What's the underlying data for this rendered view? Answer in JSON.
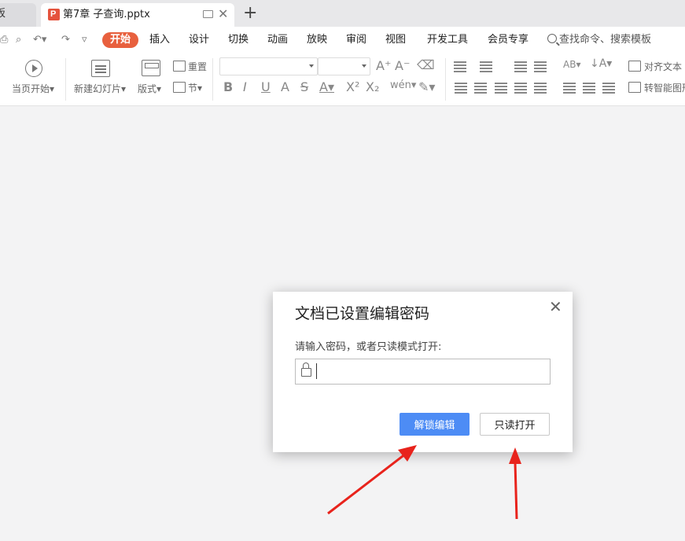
{
  "tabs": {
    "previous_tab_label": "板",
    "active_tab_title": "第7章 子查询.pptx"
  },
  "menu": {
    "items": [
      "开始",
      "插入",
      "设计",
      "切换",
      "动画",
      "放映",
      "审阅",
      "视图",
      "开发工具",
      "会员专享"
    ],
    "active_item": "开始",
    "search_label": "查找命令、搜索模板"
  },
  "ribbon": {
    "play_from_current": "当页开始",
    "new_slide": "新建幻灯片",
    "layout": "版式",
    "reset": "重置",
    "section": "节",
    "align_text": "对齐文本",
    "smart_convert": "转智能图形"
  },
  "dialog": {
    "title": "文档已设置编辑密码",
    "prompt": "请输入密码，或者只读模式打开:",
    "password_value": "",
    "unlock_button": "解锁编辑",
    "readonly_button": "只读打开"
  },
  "colors": {
    "accent_active_tab": "#e8603e",
    "primary_button": "#4d8cf5",
    "annotation_arrow": "#e8231c"
  }
}
